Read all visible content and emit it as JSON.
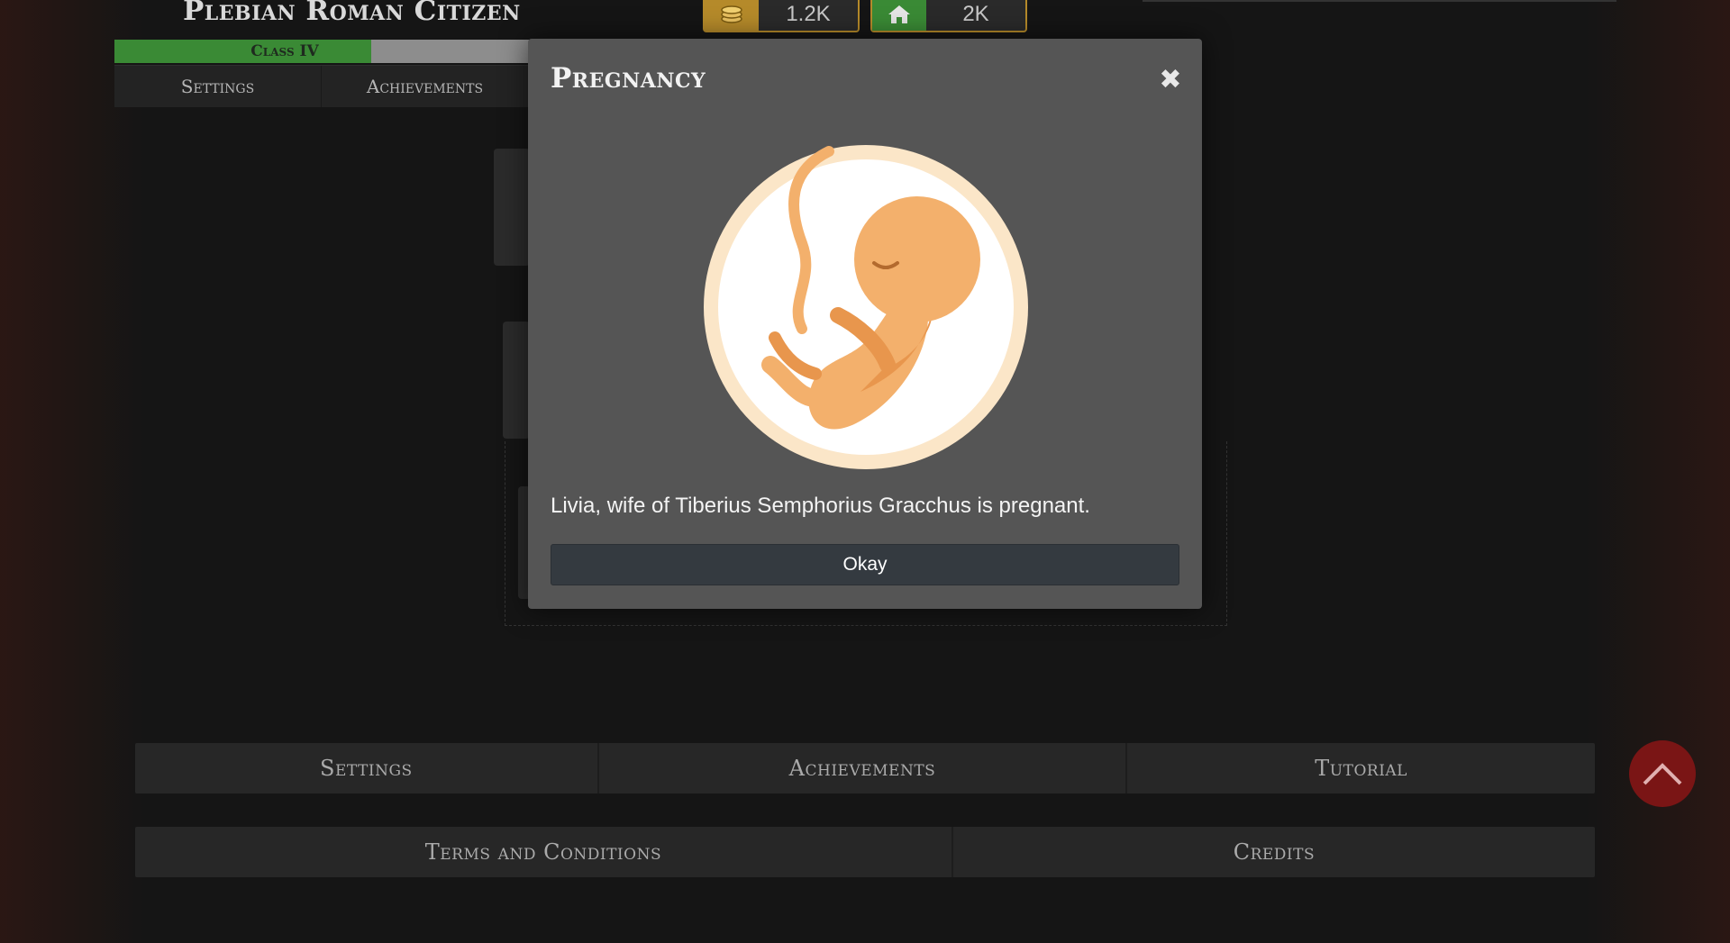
{
  "header": {
    "title": "Plebian Roman Citizen",
    "resources": [
      {
        "icon": "coins-icon",
        "value": "1.2K"
      },
      {
        "icon": "home-icon",
        "value": "2K"
      }
    ],
    "class_progress": {
      "label": "Class IV",
      "fraction": 0.62
    },
    "nav": [
      "Settings",
      "Achievements"
    ]
  },
  "modal": {
    "title": "Pregnancy",
    "close_symbol": "✖",
    "image": "fetus-in-womb-illustration",
    "message": "Livia, wife of Tiberius Semphorius Gracchus is pregnant.",
    "button": "Okay"
  },
  "footer": {
    "row1": [
      "Settings",
      "Achievements",
      "Tutorial"
    ],
    "row2": [
      "Terms and Conditions",
      "Credits"
    ]
  },
  "colors": {
    "accent_gold": "#b58a2a",
    "progress_green": "#3a8a35",
    "scroll_top_red": "#7a1515"
  }
}
